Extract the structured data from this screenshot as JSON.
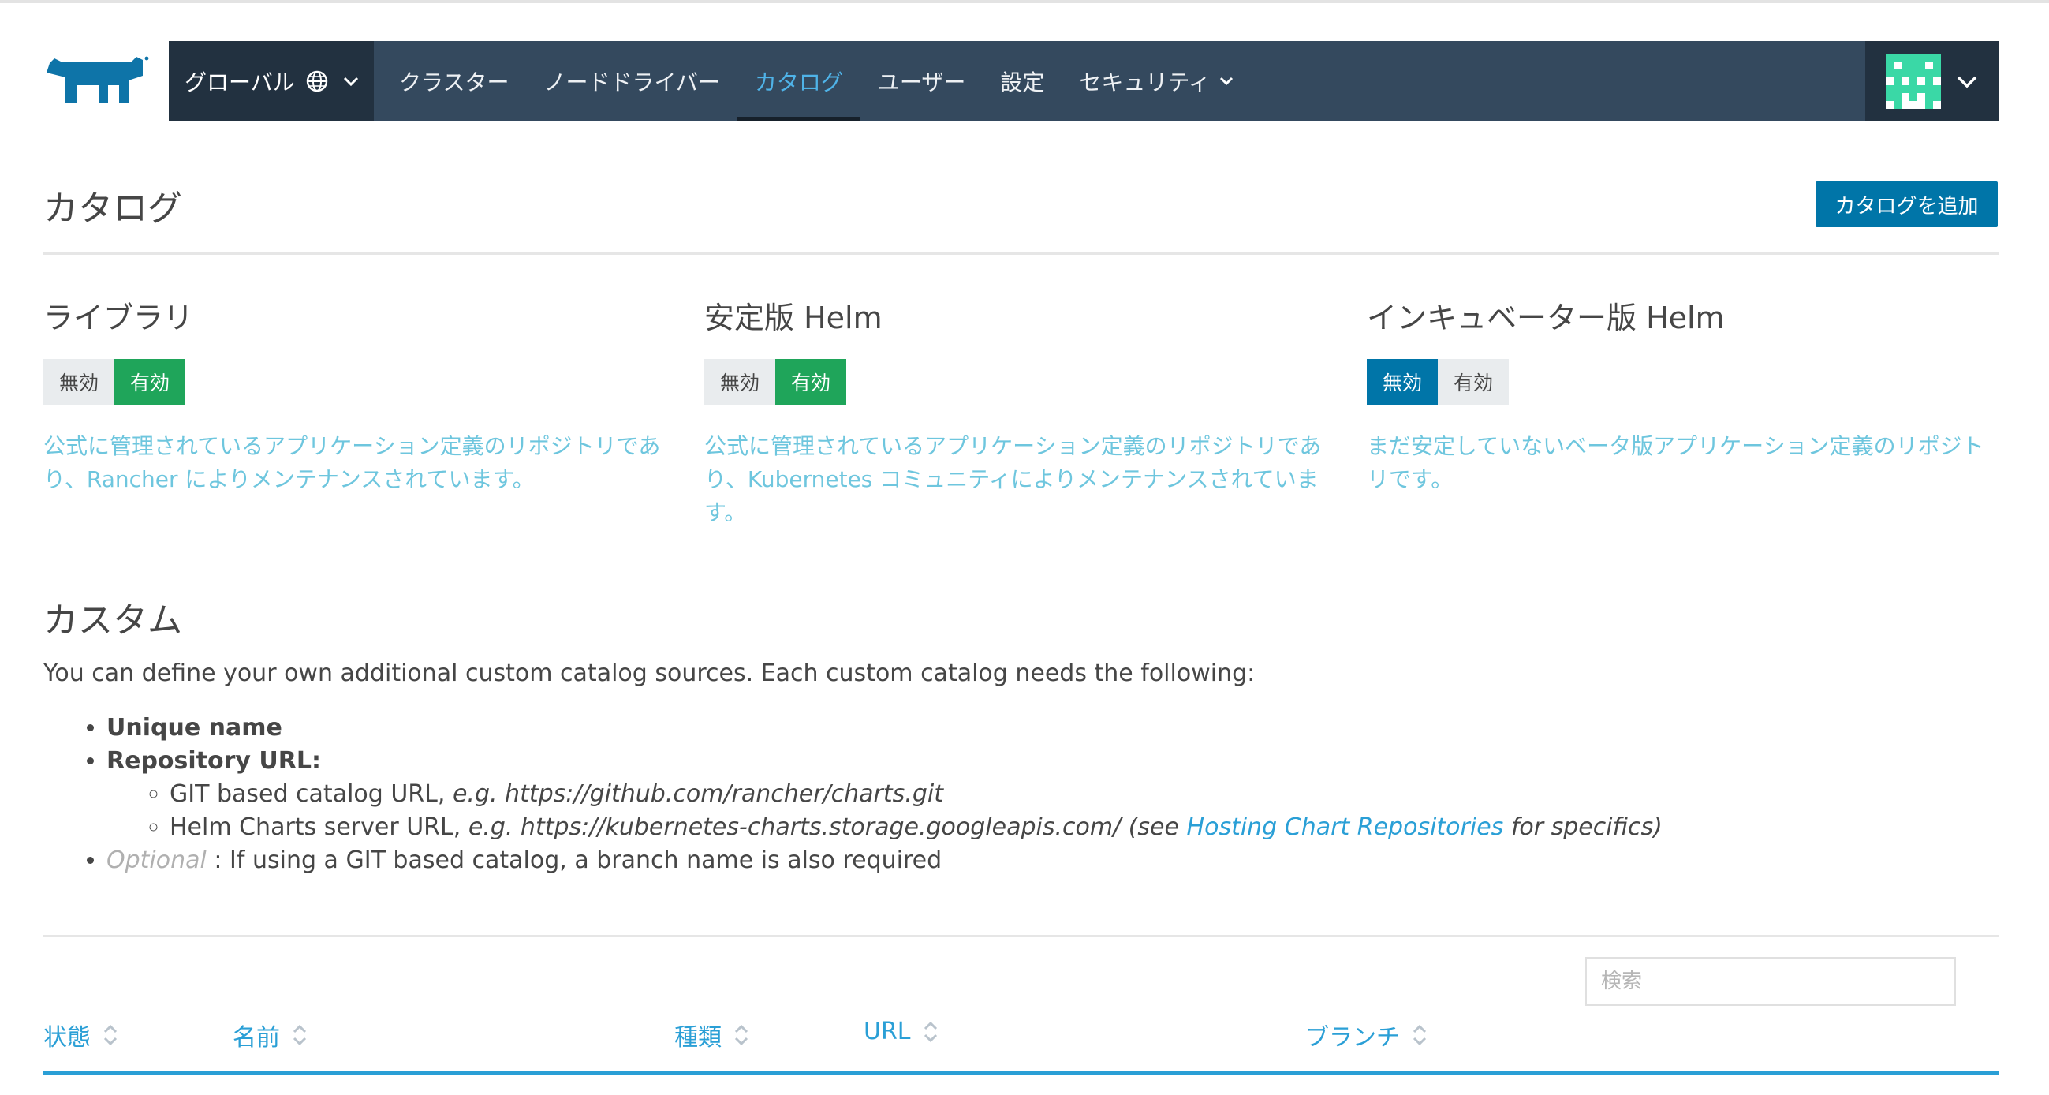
{
  "nav": {
    "global_label": "グローバル",
    "items": [
      {
        "label": "クラスター"
      },
      {
        "label": "ノードドライバー"
      },
      {
        "label": "カタログ",
        "active": true
      },
      {
        "label": "ユーザー"
      },
      {
        "label": "設定"
      },
      {
        "label": "セキュリティ",
        "dropdown": true
      }
    ],
    "colors": {
      "bar": "#34495e",
      "dark": "#223140",
      "active_text": "#4fb3e8"
    }
  },
  "page": {
    "title": "カタログ",
    "add_button": "カタログを追加"
  },
  "catalogs": [
    {
      "name": "ライブラリ",
      "disable_label": "無効",
      "enable_label": "有効",
      "state": "enabled",
      "description": "公式に管理されているアプリケーション定義のリポジトリであり、Rancher によりメンテナンスされています。"
    },
    {
      "name": "安定版 Helm",
      "disable_label": "無効",
      "enable_label": "有効",
      "state": "enabled",
      "description": "公式に管理されているアプリケーション定義のリポジトリであり、Kubernetes コミュニティによりメンテナンスされています。"
    },
    {
      "name": "インキュベーター版 Helm",
      "disable_label": "無効",
      "enable_label": "有効",
      "state": "disabled",
      "description": "まだ安定していないベータ版アプリケーション定義のリポジトリです。"
    }
  ],
  "custom": {
    "title": "カスタム",
    "description": "You can define your own additional custom catalog sources. Each custom catalog needs the following:",
    "req_unique_name": "Unique name",
    "req_repo_url": "Repository URL:",
    "git_prefix": "GIT based catalog URL,",
    "git_example": "e.g. https://github.com/rancher/charts.git",
    "helm_prefix": "Helm Charts server URL,",
    "helm_example": "e.g. https://kubernetes-charts.storage.googleapis.com/ (see",
    "helm_link": "Hosting Chart Repositories",
    "helm_suffix": "for specifics)",
    "optional_label": "Optional",
    "optional_text": ": If using a GIT based catalog, a branch name is also required"
  },
  "table": {
    "search_placeholder": "検索",
    "columns": [
      "状態",
      "名前",
      "種類",
      "URL",
      "ブランチ"
    ]
  }
}
